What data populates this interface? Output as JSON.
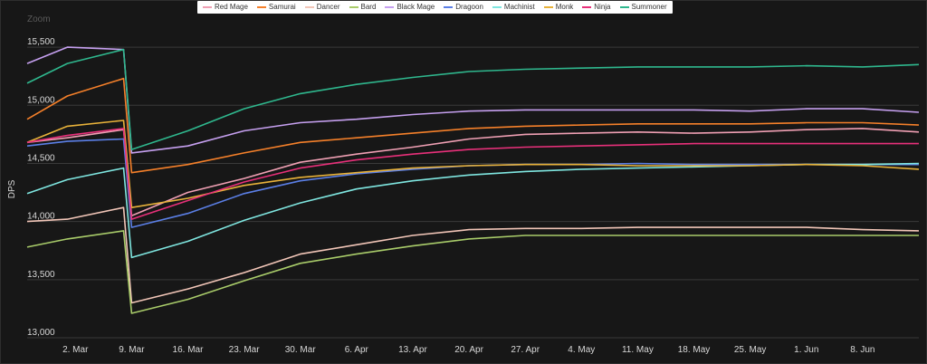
{
  "legend": {
    "items": [
      {
        "label": "Red Mage",
        "color": "#f0a0b4"
      },
      {
        "label": "Samurai",
        "color": "#f5802a"
      },
      {
        "label": "Dancer",
        "color": "#f2c6b8"
      },
      {
        "label": "Bard",
        "color": "#a9cc6a"
      },
      {
        "label": "Black Mage",
        "color": "#c6a0f0"
      },
      {
        "label": "Dragoon",
        "color": "#5b7fe6"
      },
      {
        "label": "Machinist",
        "color": "#7fe6e0"
      },
      {
        "label": "Monk",
        "color": "#e8b23a"
      },
      {
        "label": "Ninja",
        "color": "#e8307a"
      },
      {
        "label": "Summoner",
        "color": "#2fb88e"
      }
    ]
  },
  "zoom_label": "Zoom",
  "chart_data": {
    "type": "line",
    "ylabel": "DPS",
    "xlabel": "",
    "ylim": [
      13000,
      15750
    ],
    "yticks": [
      13000,
      13500,
      14000,
      14500,
      15000,
      15500
    ],
    "ytick_labels": [
      "13,000",
      "13,500",
      "14,000",
      "14,500",
      "15,000",
      "15,500"
    ],
    "xlim": [
      "2019-02-24",
      "2019-06-15"
    ],
    "xticks": [
      "2019-03-02",
      "2019-03-09",
      "2019-03-16",
      "2019-03-23",
      "2019-03-30",
      "2019-04-06",
      "2019-04-13",
      "2019-04-20",
      "2019-04-27",
      "2019-05-04",
      "2019-05-11",
      "2019-05-18",
      "2019-05-25",
      "2019-06-01",
      "2019-06-08"
    ],
    "xtick_labels": [
      "2. Mar",
      "9. Mar",
      "16. Mar",
      "23. Mar",
      "30. Mar",
      "6. Apr",
      "13. Apr",
      "20. Apr",
      "27. Apr",
      "4. May",
      "11. May",
      "18. May",
      "25. May",
      "1. Jun",
      "8. Jun"
    ],
    "grid": true,
    "legend_position": "top",
    "series": [
      {
        "name": "Red Mage",
        "color": "#f0a0b4",
        "points": [
          [
            "2019-02-24",
            14680
          ],
          [
            "2019-03-01",
            14720
          ],
          [
            "2019-03-08",
            14790
          ],
          [
            "2019-03-09",
            14050
          ],
          [
            "2019-03-16",
            14250
          ],
          [
            "2019-03-23",
            14370
          ],
          [
            "2019-03-30",
            14510
          ],
          [
            "2019-04-06",
            14580
          ],
          [
            "2019-04-13",
            14640
          ],
          [
            "2019-04-20",
            14710
          ],
          [
            "2019-04-27",
            14750
          ],
          [
            "2019-05-04",
            14760
          ],
          [
            "2019-05-11",
            14770
          ],
          [
            "2019-05-18",
            14760
          ],
          [
            "2019-05-25",
            14770
          ],
          [
            "2019-06-01",
            14790
          ],
          [
            "2019-06-08",
            14800
          ],
          [
            "2019-06-15",
            14770
          ]
        ]
      },
      {
        "name": "Samurai",
        "color": "#f5802a",
        "points": [
          [
            "2019-02-24",
            14880
          ],
          [
            "2019-03-01",
            15080
          ],
          [
            "2019-03-08",
            15230
          ],
          [
            "2019-03-09",
            14420
          ],
          [
            "2019-03-16",
            14490
          ],
          [
            "2019-03-23",
            14590
          ],
          [
            "2019-03-30",
            14680
          ],
          [
            "2019-04-06",
            14720
          ],
          [
            "2019-04-13",
            14760
          ],
          [
            "2019-04-20",
            14800
          ],
          [
            "2019-04-27",
            14820
          ],
          [
            "2019-05-04",
            14830
          ],
          [
            "2019-05-11",
            14840
          ],
          [
            "2019-05-18",
            14840
          ],
          [
            "2019-05-25",
            14840
          ],
          [
            "2019-06-01",
            14850
          ],
          [
            "2019-06-08",
            14850
          ],
          [
            "2019-06-15",
            14830
          ]
        ]
      },
      {
        "name": "Dancer",
        "color": "#f2c6b8",
        "points": [
          [
            "2019-02-24",
            14000
          ],
          [
            "2019-03-01",
            14020
          ],
          [
            "2019-03-08",
            14120
          ],
          [
            "2019-03-09",
            13300
          ],
          [
            "2019-03-16",
            13420
          ],
          [
            "2019-03-23",
            13560
          ],
          [
            "2019-03-30",
            13720
          ],
          [
            "2019-04-06",
            13800
          ],
          [
            "2019-04-13",
            13880
          ],
          [
            "2019-04-20",
            13930
          ],
          [
            "2019-04-27",
            13940
          ],
          [
            "2019-05-04",
            13940
          ],
          [
            "2019-05-11",
            13950
          ],
          [
            "2019-05-18",
            13950
          ],
          [
            "2019-05-25",
            13950
          ],
          [
            "2019-06-01",
            13950
          ],
          [
            "2019-06-08",
            13930
          ],
          [
            "2019-06-15",
            13920
          ]
        ]
      },
      {
        "name": "Bard",
        "color": "#a9cc6a",
        "points": [
          [
            "2019-02-24",
            13780
          ],
          [
            "2019-03-01",
            13850
          ],
          [
            "2019-03-08",
            13920
          ],
          [
            "2019-03-09",
            13210
          ],
          [
            "2019-03-16",
            13330
          ],
          [
            "2019-03-23",
            13490
          ],
          [
            "2019-03-30",
            13640
          ],
          [
            "2019-04-06",
            13720
          ],
          [
            "2019-04-13",
            13790
          ],
          [
            "2019-04-20",
            13850
          ],
          [
            "2019-04-27",
            13880
          ],
          [
            "2019-05-04",
            13880
          ],
          [
            "2019-05-11",
            13880
          ],
          [
            "2019-05-18",
            13880
          ],
          [
            "2019-05-25",
            13880
          ],
          [
            "2019-06-01",
            13880
          ],
          [
            "2019-06-08",
            13880
          ],
          [
            "2019-06-15",
            13880
          ]
        ]
      },
      {
        "name": "Black Mage",
        "color": "#c6a0f0",
        "points": [
          [
            "2019-02-24",
            15360
          ],
          [
            "2019-03-01",
            15500
          ],
          [
            "2019-03-08",
            15480
          ],
          [
            "2019-03-09",
            14590
          ],
          [
            "2019-03-16",
            14650
          ],
          [
            "2019-03-23",
            14780
          ],
          [
            "2019-03-30",
            14850
          ],
          [
            "2019-04-06",
            14880
          ],
          [
            "2019-04-13",
            14920
          ],
          [
            "2019-04-20",
            14950
          ],
          [
            "2019-04-27",
            14960
          ],
          [
            "2019-05-04",
            14960
          ],
          [
            "2019-05-11",
            14960
          ],
          [
            "2019-05-18",
            14960
          ],
          [
            "2019-05-25",
            14950
          ],
          [
            "2019-06-01",
            14970
          ],
          [
            "2019-06-08",
            14970
          ],
          [
            "2019-06-15",
            14940
          ]
        ]
      },
      {
        "name": "Dragoon",
        "color": "#5b7fe6",
        "points": [
          [
            "2019-02-24",
            14650
          ],
          [
            "2019-03-01",
            14690
          ],
          [
            "2019-03-08",
            14710
          ],
          [
            "2019-03-09",
            13950
          ],
          [
            "2019-03-16",
            14070
          ],
          [
            "2019-03-23",
            14240
          ],
          [
            "2019-03-30",
            14350
          ],
          [
            "2019-04-06",
            14410
          ],
          [
            "2019-04-13",
            14450
          ],
          [
            "2019-04-20",
            14480
          ],
          [
            "2019-04-27",
            14490
          ],
          [
            "2019-05-04",
            14490
          ],
          [
            "2019-05-11",
            14500
          ],
          [
            "2019-05-18",
            14490
          ],
          [
            "2019-05-25",
            14490
          ],
          [
            "2019-06-01",
            14490
          ],
          [
            "2019-06-08",
            14490
          ],
          [
            "2019-06-15",
            14490
          ]
        ]
      },
      {
        "name": "Machinist",
        "color": "#7fe6e0",
        "points": [
          [
            "2019-02-24",
            14240
          ],
          [
            "2019-03-01",
            14360
          ],
          [
            "2019-03-08",
            14460
          ],
          [
            "2019-03-09",
            13690
          ],
          [
            "2019-03-16",
            13830
          ],
          [
            "2019-03-23",
            14010
          ],
          [
            "2019-03-30",
            14160
          ],
          [
            "2019-04-06",
            14280
          ],
          [
            "2019-04-13",
            14350
          ],
          [
            "2019-04-20",
            14400
          ],
          [
            "2019-04-27",
            14430
          ],
          [
            "2019-05-04",
            14450
          ],
          [
            "2019-05-11",
            14460
          ],
          [
            "2019-05-18",
            14470
          ],
          [
            "2019-05-25",
            14480
          ],
          [
            "2019-06-01",
            14490
          ],
          [
            "2019-06-08",
            14490
          ],
          [
            "2019-06-15",
            14500
          ]
        ]
      },
      {
        "name": "Monk",
        "color": "#e8b23a",
        "points": [
          [
            "2019-02-24",
            14680
          ],
          [
            "2019-03-01",
            14820
          ],
          [
            "2019-03-08",
            14870
          ],
          [
            "2019-03-09",
            14120
          ],
          [
            "2019-03-16",
            14200
          ],
          [
            "2019-03-23",
            14310
          ],
          [
            "2019-03-30",
            14380
          ],
          [
            "2019-04-06",
            14420
          ],
          [
            "2019-04-13",
            14460
          ],
          [
            "2019-04-20",
            14480
          ],
          [
            "2019-04-27",
            14490
          ],
          [
            "2019-05-04",
            14490
          ],
          [
            "2019-05-11",
            14480
          ],
          [
            "2019-05-18",
            14480
          ],
          [
            "2019-05-25",
            14480
          ],
          [
            "2019-06-01",
            14490
          ],
          [
            "2019-06-08",
            14480
          ],
          [
            "2019-06-15",
            14450
          ]
        ]
      },
      {
        "name": "Ninja",
        "color": "#e8307a",
        "points": [
          [
            "2019-02-24",
            14680
          ],
          [
            "2019-03-01",
            14740
          ],
          [
            "2019-03-08",
            14800
          ],
          [
            "2019-03-09",
            14020
          ],
          [
            "2019-03-16",
            14180
          ],
          [
            "2019-03-23",
            14340
          ],
          [
            "2019-03-30",
            14460
          ],
          [
            "2019-04-06",
            14530
          ],
          [
            "2019-04-13",
            14580
          ],
          [
            "2019-04-20",
            14620
          ],
          [
            "2019-04-27",
            14640
          ],
          [
            "2019-05-04",
            14650
          ],
          [
            "2019-05-11",
            14660
          ],
          [
            "2019-05-18",
            14670
          ],
          [
            "2019-05-25",
            14670
          ],
          [
            "2019-06-01",
            14670
          ],
          [
            "2019-06-08",
            14670
          ],
          [
            "2019-06-15",
            14670
          ]
        ]
      },
      {
        "name": "Summoner",
        "color": "#2fb88e",
        "points": [
          [
            "2019-02-24",
            15190
          ],
          [
            "2019-03-01",
            15360
          ],
          [
            "2019-03-08",
            15480
          ],
          [
            "2019-03-09",
            14620
          ],
          [
            "2019-03-16",
            14780
          ],
          [
            "2019-03-23",
            14970
          ],
          [
            "2019-03-30",
            15100
          ],
          [
            "2019-04-06",
            15180
          ],
          [
            "2019-04-13",
            15240
          ],
          [
            "2019-04-20",
            15290
          ],
          [
            "2019-04-27",
            15310
          ],
          [
            "2019-05-04",
            15320
          ],
          [
            "2019-05-11",
            15330
          ],
          [
            "2019-05-18",
            15330
          ],
          [
            "2019-05-25",
            15330
          ],
          [
            "2019-06-01",
            15340
          ],
          [
            "2019-06-08",
            15330
          ],
          [
            "2019-06-15",
            15350
          ]
        ]
      }
    ]
  }
}
